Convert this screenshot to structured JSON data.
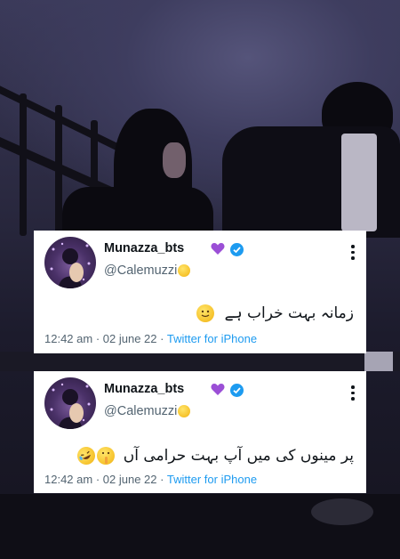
{
  "tweets": [
    {
      "display_name": "Munazza_bts",
      "name_emoji": "purple-heart-icon",
      "handle": "@Calemuzzi",
      "handle_emoji": "pleading-face-icon",
      "text": "زمانہ بہت خراب ہے",
      "text_emojis": [
        "slightly-smiling-face-icon"
      ],
      "time": "12:42 am",
      "date": "02 june 22",
      "source": "Twitter for iPhone"
    },
    {
      "display_name": "Munazza_bts",
      "name_emoji": "purple-heart-icon",
      "handle": "@Calemuzzi",
      "handle_emoji": "pleading-face-icon",
      "text": "پر مینوں کی میں آپ بہت حرامی آں",
      "text_emojis": [
        "shushing-face-icon",
        "rolling-on-floor-laughing-icon"
      ],
      "time": "12:42 am",
      "date": "02 june 22",
      "source": "Twitter for iPhone"
    }
  ],
  "separator": "·",
  "colors": {
    "verified": "#1d9bf0",
    "heart": "#9b4fd6",
    "link": "#1d9bf0",
    "muted": "#536471",
    "text": "#0f1419"
  }
}
